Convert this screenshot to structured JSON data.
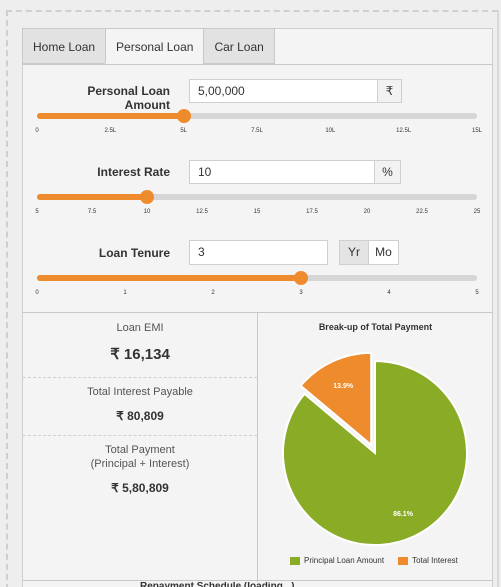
{
  "tabs": [
    {
      "label": "Home Loan",
      "active": false
    },
    {
      "label": "Personal Loan",
      "active": true
    },
    {
      "label": "Car Loan",
      "active": false
    }
  ],
  "loan_amount": {
    "label": "Personal Loan Amount",
    "value": "5,00,000",
    "unit": "₹",
    "slider_fraction": 0.3333,
    "ticks": [
      "0",
      "2.5L",
      "5L",
      "7.5L",
      "10L",
      "12.5L",
      "15L"
    ]
  },
  "interest_rate": {
    "label": "Interest Rate",
    "value": "10",
    "unit": "%",
    "slider_fraction": 0.25,
    "ticks": [
      "5",
      "7.5",
      "10",
      "12.5",
      "15",
      "17.5",
      "20",
      "22.5",
      "25"
    ]
  },
  "tenure": {
    "label": "Loan Tenure",
    "value": "3",
    "unit_year": "Yr",
    "unit_month": "Mo",
    "selected_unit": "Yr",
    "slider_fraction": 0.6,
    "ticks": [
      "0",
      "1",
      "2",
      "3",
      "4",
      "5"
    ]
  },
  "results": {
    "emi_label": "Loan EMI",
    "emi_value": "₹ 16,134",
    "interest_label": "Total Interest Payable",
    "interest_value": "₹ 80,809",
    "total_label_line1": "Total Payment",
    "total_label_line2": "(Principal + Interest)",
    "total_value": "₹ 5,80,809"
  },
  "colors": {
    "accent": "#ed8b2d",
    "principal": "#8aab26",
    "interest": "#ed8b2d"
  },
  "chart_data": {
    "type": "pie",
    "title": "Break-up of Total Payment",
    "slices": [
      {
        "name": "Principal Loan Amount",
        "value": 86.1,
        "label": "86.1%",
        "color": "#8aab26"
      },
      {
        "name": "Total Interest",
        "value": 13.9,
        "label": "13.9%",
        "color": "#ed8b2d",
        "exploded": true
      }
    ],
    "legend_position": "bottom"
  },
  "footer_text": "Repayment Schedule (loading...)"
}
